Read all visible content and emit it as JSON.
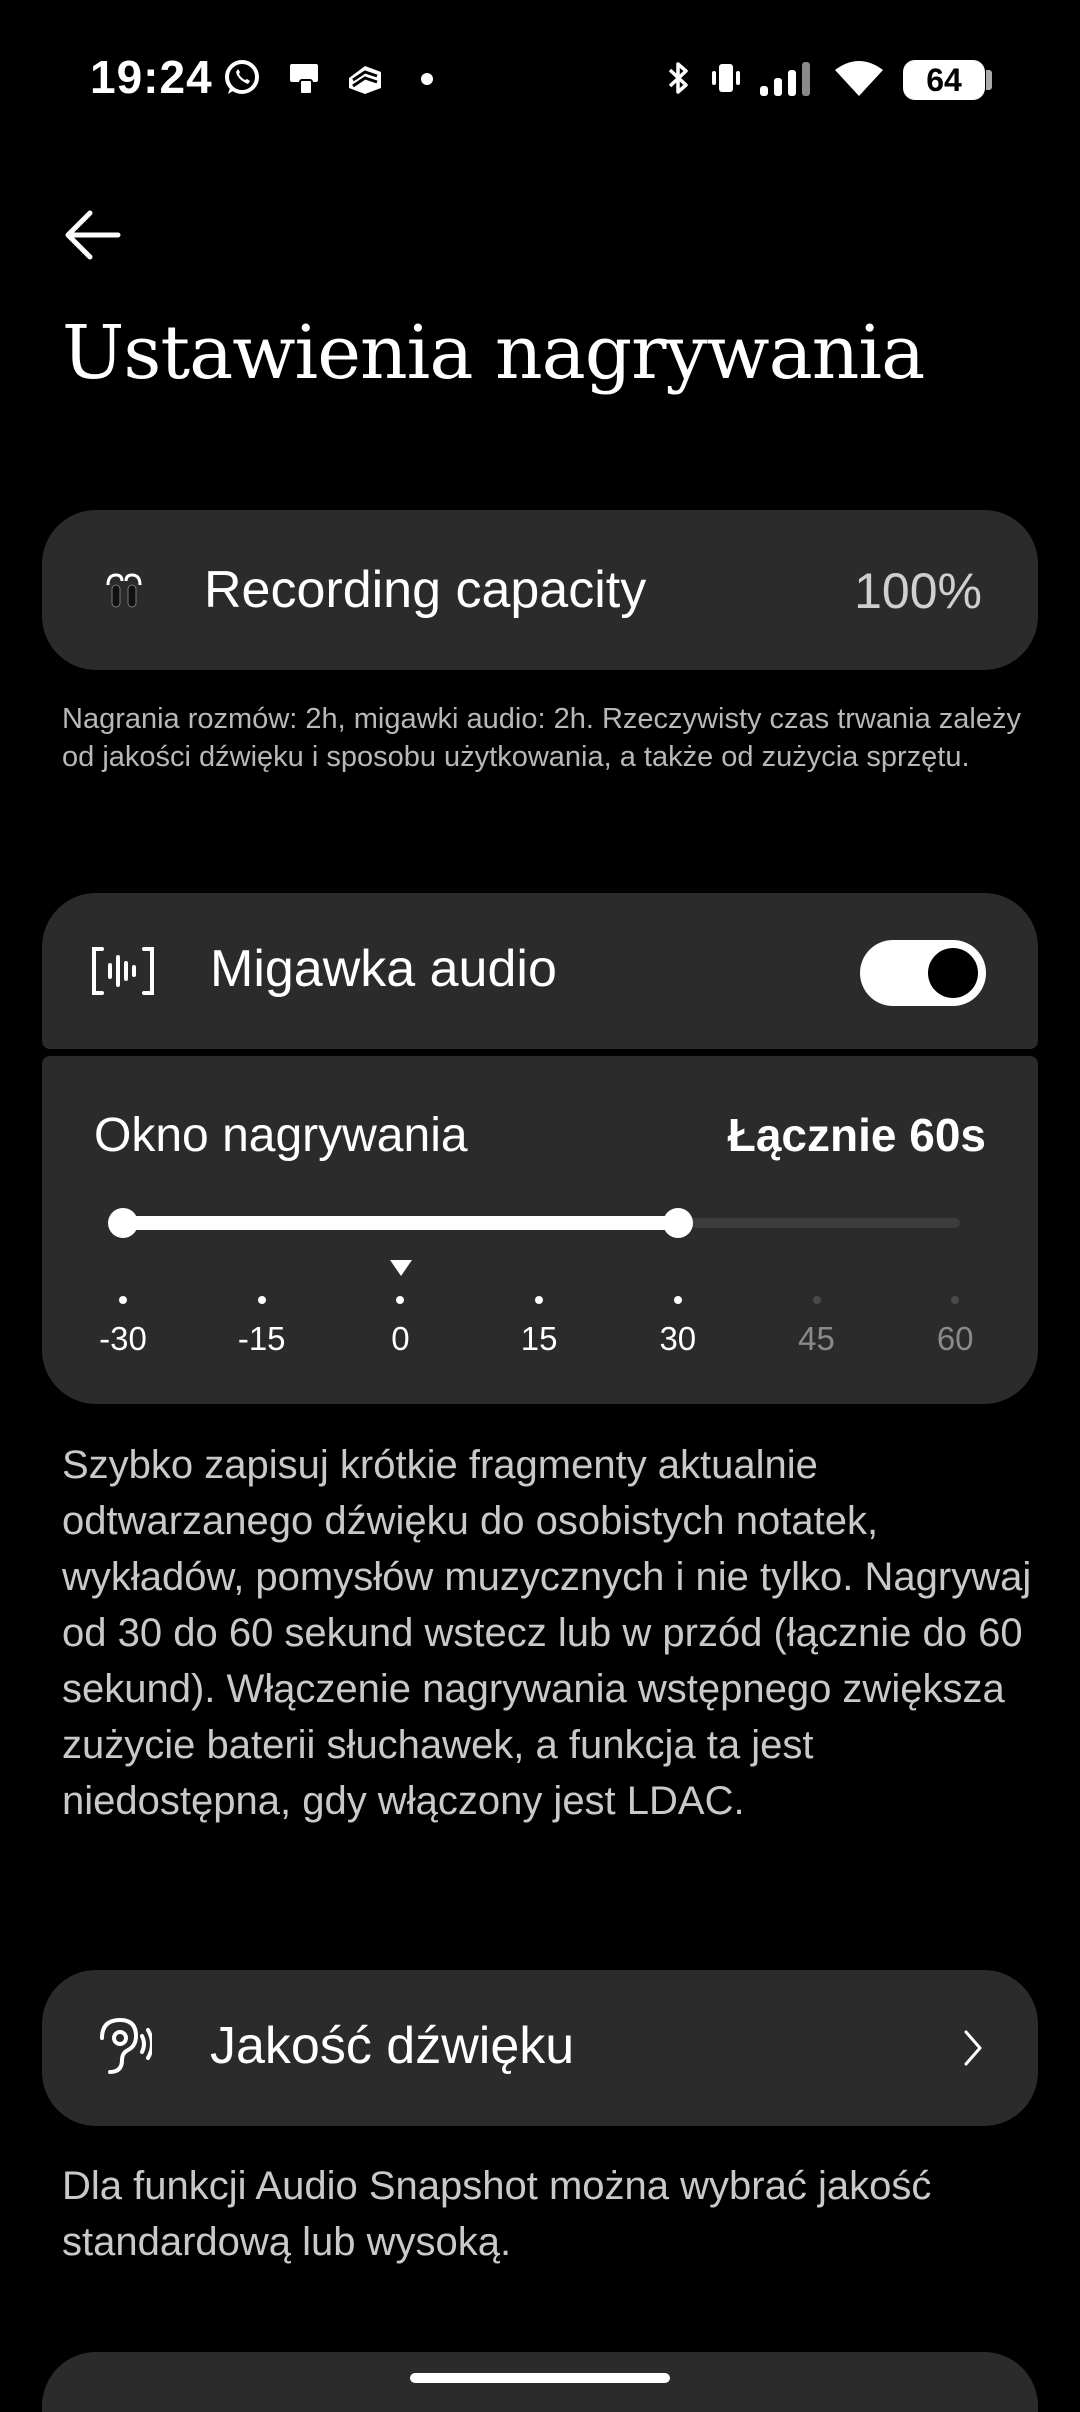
{
  "status_bar": {
    "time": "19:24",
    "battery": "64",
    "left_icons": [
      "whatsapp-icon",
      "device-icon",
      "app-icon",
      "dot-icon"
    ],
    "right_icons": [
      "bluetooth-icon",
      "vibrate-icon",
      "signal-icon",
      "wifi-icon"
    ]
  },
  "header": {
    "title": "Ustawienia nagrywania"
  },
  "capacity": {
    "label": "Recording capacity",
    "value": "100%",
    "description": "Nagrania rozmów: 2h, migawki audio: 2h. Rzeczywisty czas trwania zależy od jakości dźwięku i sposobu użytkowania, a także od zużycia sprzętu."
  },
  "snapshot": {
    "label": "Migawka audio",
    "toggle_on": true
  },
  "window": {
    "label": "Okno nagrywania",
    "total": "Łącznie 60s",
    "range_start": -30,
    "range_end": 30,
    "ticks": [
      "-30",
      "-15",
      "0",
      "15",
      "30",
      "45",
      "60"
    ],
    "description": "Szybko zapisuj krótkie fragmenty aktualnie odtwarzanego dźwięku do osobistych notatek, wykładów, pomysłów muzycznych i nie tylko. Nagrywaj od 30 do 60 sekund wstecz lub w przód (łącznie do 60 sekund). Włączenie nagrywania wstępnego zwiększa zużycie baterii słuchawek, a funkcja ta jest niedostępna, gdy włączony jest LDAC."
  },
  "quality": {
    "label": "Jakość dźwięku",
    "description": "Dla funkcji Audio Snapshot można wybrać jakość standardową lub wysoką."
  },
  "colors": {
    "background": "#000000",
    "card": "#2b2b2b",
    "accent": "#ffffff",
    "muted_text": "#b8b8b8"
  }
}
